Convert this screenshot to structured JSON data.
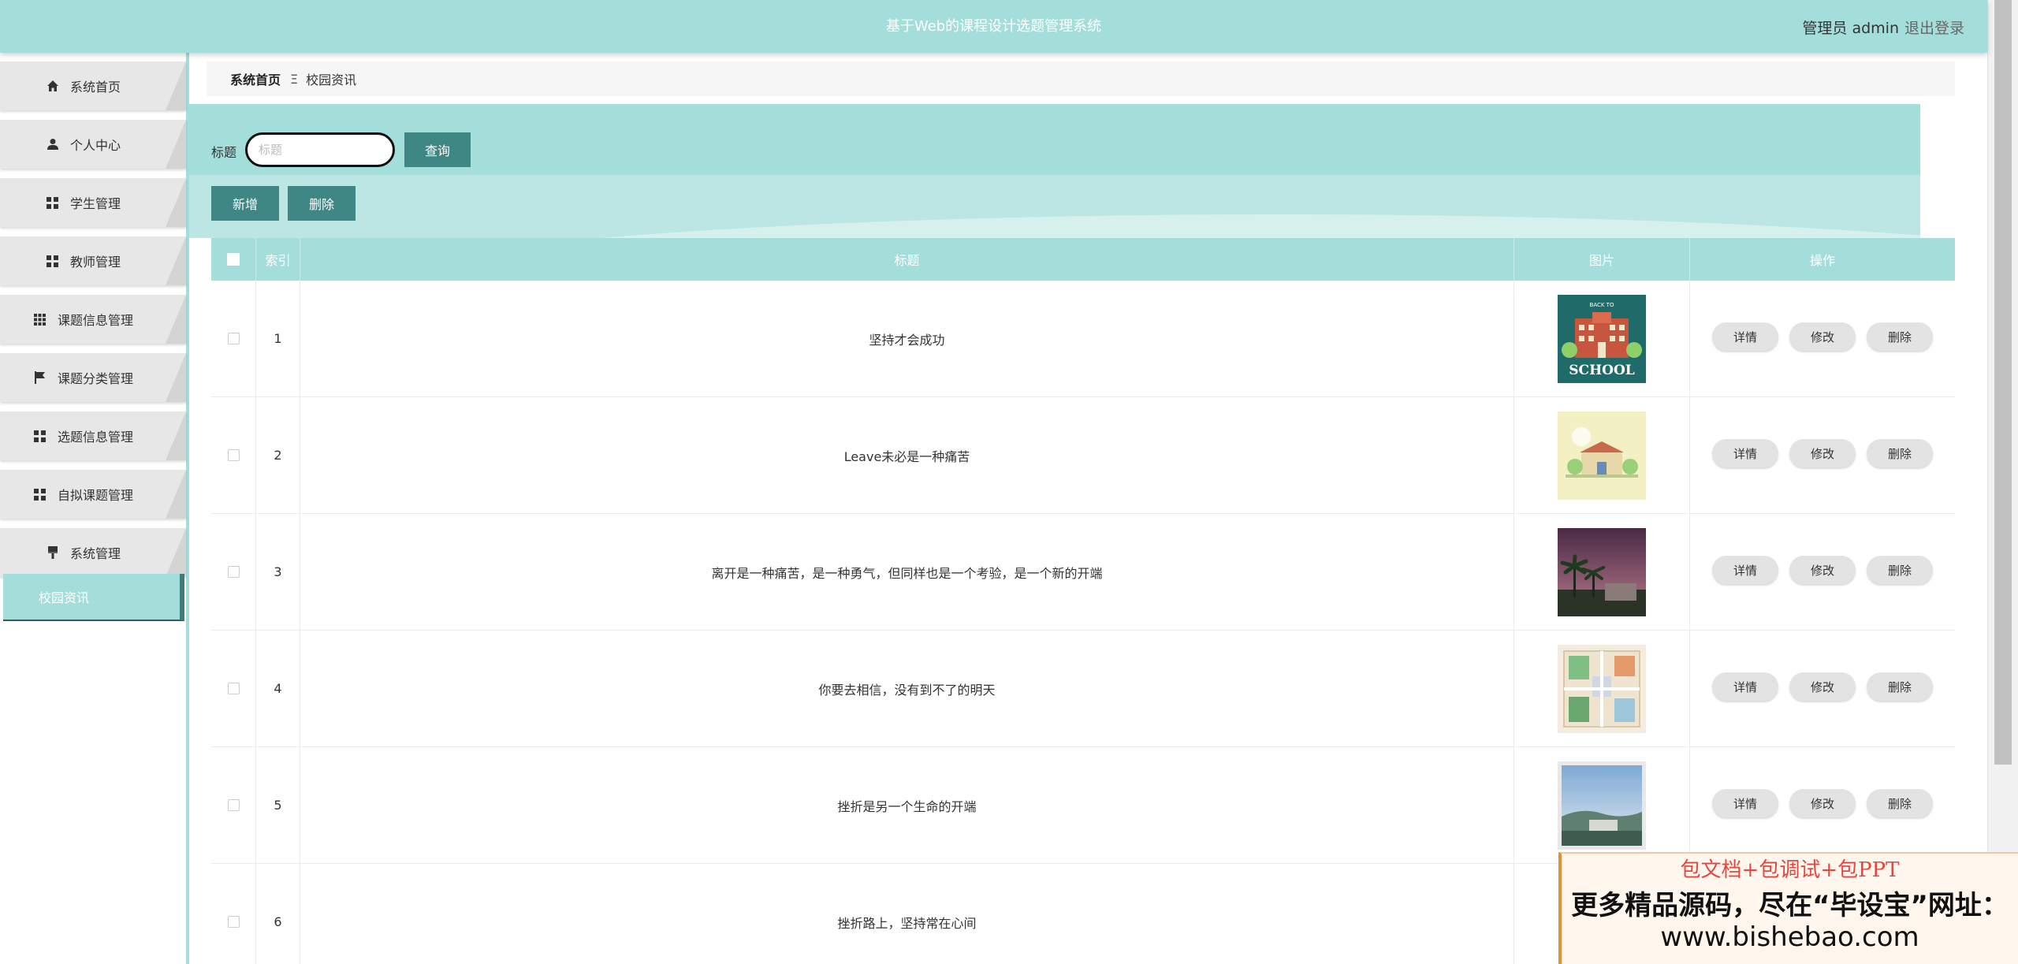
{
  "header": {
    "title": "基于Web的课程设计选题管理系统",
    "user": "管理员 admin",
    "logout": "退出登录"
  },
  "sidebar": {
    "items": [
      {
        "label": "系统首页",
        "icon": "home-icon"
      },
      {
        "label": "个人中心",
        "icon": "user-icon"
      },
      {
        "label": "学生管理",
        "icon": "grid-icon"
      },
      {
        "label": "教师管理",
        "icon": "grid-icon"
      },
      {
        "label": "课题信息管理",
        "icon": "apps-icon"
      },
      {
        "label": "课题分类管理",
        "icon": "flag-icon"
      },
      {
        "label": "选题信息管理",
        "icon": "grid-icon"
      },
      {
        "label": "自拟课题管理",
        "icon": "grid-icon"
      },
      {
        "label": "系统管理",
        "icon": "brush-icon"
      }
    ],
    "active": "校园资讯"
  },
  "breadcrumb": {
    "home": "系统首页",
    "separator": "Ξ",
    "current": "校园资讯"
  },
  "search": {
    "label": "标题",
    "placeholder": "标题",
    "button": "查询"
  },
  "toolbar": {
    "add": "新增",
    "delete": "删除"
  },
  "table": {
    "columns": [
      "索引",
      "标题",
      "图片",
      "操作"
    ],
    "rows": [
      {
        "index": "1",
        "title": "坚持才会成功",
        "image": "school-thumbnail"
      },
      {
        "index": "2",
        "title": "Leave未必是一种痛苦",
        "image": "campus-building-thumbnail"
      },
      {
        "index": "3",
        "title": "离开是一种痛苦，是一种勇气，但同样也是一个考验，是一个新的开端",
        "image": "palm-trees-thumbnail"
      },
      {
        "index": "4",
        "title": "你要去相信，没有到不了的明天",
        "image": "campus-map-thumbnail"
      },
      {
        "index": "5",
        "title": "挫折是另一个生命的开端",
        "image": "campus-photo-thumbnail"
      },
      {
        "index": "6",
        "title": "挫折路上，坚持常在心间",
        "image": ""
      }
    ],
    "actions": {
      "detail": "详情",
      "edit": "修改",
      "delete": "删除"
    }
  },
  "thumb_text": {
    "school_top": "BACK TO",
    "school": "SCHOOL"
  },
  "ad": {
    "line1": "包文档+包调试+包PPT",
    "line2": "更多精品源码，尽在“毕设宝”网址：",
    "line3": "www.bishebao.com"
  },
  "colors": {
    "header_bg": "#a4dedb",
    "button_bg": "#3f8784",
    "active_border": "#3f7c78"
  }
}
